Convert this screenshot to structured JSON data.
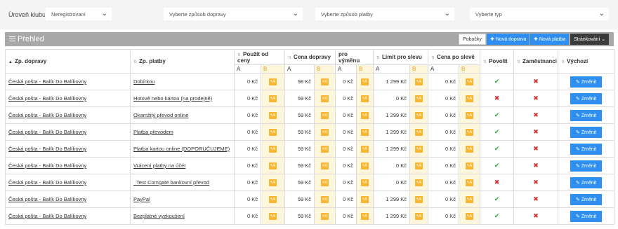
{
  "filters": {
    "club_label": "Úroveň klubu:",
    "club_value": "Neregistrovaní",
    "shipping_placeholder": "Vyberte způsob dopravy",
    "payment_placeholder": "Vyberte způsob platby",
    "type_placeholder": "Vyberte typ"
  },
  "panel": {
    "title": "Přehled",
    "btn_branches": "Pobočky",
    "btn_new_shipping": "Nová doprava",
    "btn_new_payment": "Nová platba",
    "btn_paging": "Stránkování"
  },
  "table": {
    "headers": {
      "shipping": "Zp. dopravy",
      "payment": "Zp. platby",
      "use_from_price": "Použít od ceny",
      "shipping_price": "Cena dopravy",
      "for_refund": "pro výměnu",
      "limit_discount": "Limit pro slevu",
      "price_after_discount": "Cena po slevě",
      "allow": "Povolit",
      "employees": "Zaměstnanci",
      "default": "Výchozí",
      "a": "A",
      "b": "B"
    },
    "plus_label": "+A",
    "edit_label": "Změnit",
    "rows": [
      {
        "shipping": "Česká pošta - Balík Do Balíkovny",
        "payment": "Dobírkou",
        "use_from": "0 Kč",
        "price": "98 Kč",
        "refund": "0 Kč",
        "limit": "1 299 Kč",
        "after": "0 Kč",
        "allow": true,
        "employees": false
      },
      {
        "shipping": "Česká pošta - Balík Do Balíkovny",
        "payment": "Hotově nebo kartou (na prodejně)",
        "use_from": "0 Kč",
        "price": "59 Kč",
        "refund": "0 Kč",
        "limit": "0 Kč",
        "after": "0 Kč",
        "allow": false,
        "employees": false
      },
      {
        "shipping": "Česká pošta - Balík Do Balíkovny",
        "payment": "Okamžitý převod online",
        "use_from": "0 Kč",
        "price": "59 Kč",
        "refund": "0 Kč",
        "limit": "1 299 Kč",
        "after": "0 Kč",
        "allow": true,
        "employees": false
      },
      {
        "shipping": "Česká pošta - Balík Do Balíkovny",
        "payment": "Platba převodem",
        "use_from": "0 Kč",
        "price": "59 Kč",
        "refund": "0 Kč",
        "limit": "1 299 Kč",
        "after": "0 Kč",
        "allow": true,
        "employees": false
      },
      {
        "shipping": "Česká pošta - Balík Do Balíkovny",
        "payment": "Platba kartou online (DOPORUČUJEME)",
        "use_from": "0 Kč",
        "price": "59 Kč",
        "refund": "0 Kč",
        "limit": "1 299 Kč",
        "after": "0 Kč",
        "allow": true,
        "employees": false
      },
      {
        "shipping": "Česká pošta - Balík Do Balíkovny",
        "payment": "Vrácení platby na účet",
        "use_from": "0 Kč",
        "price": "59 Kč",
        "refund": "0 Kč",
        "limit": "0 Kč",
        "after": "0 Kč",
        "allow": true,
        "employees": false
      },
      {
        "shipping": "Česká pošta - Balík Do Balíkovny",
        "payment": "_Test Comgate bankovní převod",
        "use_from": "0 Kč",
        "price": "59 Kč",
        "refund": "0 Kč",
        "limit": "0 Kč",
        "after": "0 Kč",
        "allow": false,
        "employees": false
      },
      {
        "shipping": "Česká pošta - Balík Do Balíkovny",
        "payment": "PayPal",
        "use_from": "0 Kč",
        "price": "59 Kč",
        "refund": "0 Kč",
        "limit": "1 299 Kč",
        "after": "0 Kč",
        "allow": true,
        "employees": false
      },
      {
        "shipping": "Česká pošta - Balík Do Balíkovny",
        "payment": "Bezplatné vyzkoušení",
        "use_from": "0 Kč",
        "price": "59 Kč",
        "refund": "0 Kč",
        "limit": "1 299 Kč",
        "after": "0 Kč",
        "allow": true,
        "employees": false
      }
    ]
  },
  "colors": {
    "accent_blue": "#2f8ff0",
    "plus_orange": "#f7b733",
    "ok_green": "#28a745",
    "no_red": "#d32f2f"
  }
}
